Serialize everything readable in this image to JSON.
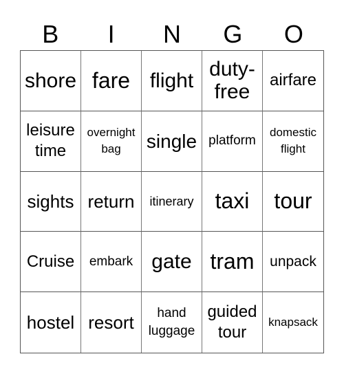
{
  "header": [
    "B",
    "I",
    "N",
    "G",
    "O"
  ],
  "cells": [
    {
      "text": "shore",
      "size": "s30"
    },
    {
      "text": "fare",
      "size": "s32"
    },
    {
      "text": "flight",
      "size": "s30"
    },
    {
      "text": "duty-\nfree",
      "size": "s30"
    },
    {
      "text": "airfare",
      "size": "s24"
    },
    {
      "text": "leisure\ntime",
      "size": "s24"
    },
    {
      "text": "overnight\nbag",
      "size": "s17"
    },
    {
      "text": "single",
      "size": "s28"
    },
    {
      "text": "platform",
      "size": "s19"
    },
    {
      "text": "domestic\nflight",
      "size": "s17"
    },
    {
      "text": "sights",
      "size": "s26"
    },
    {
      "text": "return",
      "size": "s26"
    },
    {
      "text": "itinerary",
      "size": "s18"
    },
    {
      "text": "taxi",
      "size": "s32"
    },
    {
      "text": "tour",
      "size": "s32"
    },
    {
      "text": "Cruise",
      "size": "s24"
    },
    {
      "text": "embark",
      "size": "s19"
    },
    {
      "text": "gate",
      "size": "s30"
    },
    {
      "text": "tram",
      "size": "s32"
    },
    {
      "text": "unpack",
      "size": "s21"
    },
    {
      "text": "hostel",
      "size": "s26"
    },
    {
      "text": "resort",
      "size": "s26"
    },
    {
      "text": "hand\nluggage",
      "size": "s19"
    },
    {
      "text": "guided\ntour",
      "size": "s24"
    },
    {
      "text": "knapsack",
      "size": "s17"
    }
  ]
}
